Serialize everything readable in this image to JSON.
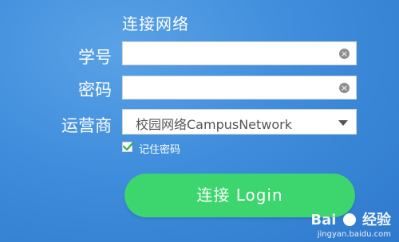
{
  "form": {
    "title": "连接网络",
    "student_id": {
      "label": "学号",
      "value": "",
      "clear_symbol": "×"
    },
    "password": {
      "label": "密码",
      "value": "",
      "clear_symbol": "×"
    },
    "operator": {
      "label": "运营商",
      "selected": "校园网络CampusNetwork"
    },
    "remember": {
      "label": "记住密码",
      "checked": true
    },
    "login_button": "连接 Login"
  },
  "watermark": {
    "logo_left": "Bai",
    "logo_right": "经验",
    "url": "jingyan.baidu.com"
  },
  "colors": {
    "background": "#3f8ddc",
    "login_button": "#3dd56d",
    "checkmark": "#2fae4f"
  },
  "icons": {
    "clear": "clear-circle-icon",
    "dropdown": "chevron-down-icon",
    "checkbox": "checkmark-icon",
    "watermark": "paw-icon"
  }
}
